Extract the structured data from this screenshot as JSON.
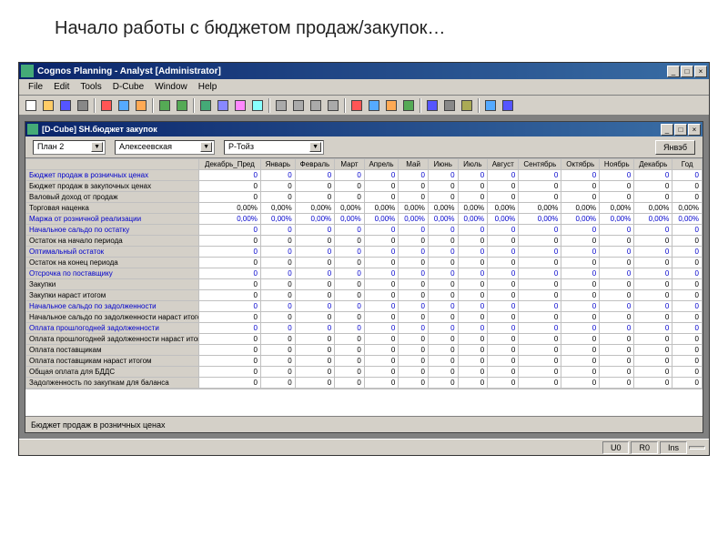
{
  "slide_title": "Начало работы с бюджетом продаж/закупок…",
  "app": {
    "title": "Cognos Planning - Analyst [Administrator]",
    "menu": [
      "File",
      "Edit",
      "Tools",
      "D-Cube",
      "Window",
      "Help"
    ],
    "inner_title": "[D-Cube] SH.бюджет закупок",
    "filters": {
      "f1": "План 2",
      "f2": "Алексеевская",
      "f3": "Р-Тойз"
    },
    "refresh": "Янвэб",
    "formula": "Бюджет продаж в розничных ценах",
    "status": {
      "u0": "U0",
      "r0": "R0",
      "ins": "Ins"
    }
  },
  "columns": [
    "Декабрь_Пред",
    "Январь",
    "Февраль",
    "Март",
    "Апрель",
    "Май",
    "Июнь",
    "Июль",
    "Август",
    "Сентябрь",
    "Октябрь",
    "Ноябрь",
    "Декабрь",
    "Год"
  ],
  "rows": [
    {
      "label": "Бюджет продаж в розничных ценах",
      "link": true,
      "vals": [
        "0",
        "0",
        "0",
        "0",
        "0",
        "0",
        "0",
        "0",
        "0",
        "0",
        "0",
        "0",
        "0",
        "0"
      ]
    },
    {
      "label": "Бюджет продаж в закупочных ценах",
      "link": false,
      "vals": [
        "0",
        "0",
        "0",
        "0",
        "0",
        "0",
        "0",
        "0",
        "0",
        "0",
        "0",
        "0",
        "0",
        "0"
      ]
    },
    {
      "label": "Валовый доход от продаж",
      "link": false,
      "vals": [
        "0",
        "0",
        "0",
        "0",
        "0",
        "0",
        "0",
        "0",
        "0",
        "0",
        "0",
        "0",
        "0",
        "0"
      ]
    },
    {
      "label": "Торговая наценка",
      "link": false,
      "vals": [
        "0,00%",
        "0,00%",
        "0,00%",
        "0,00%",
        "0,00%",
        "0,00%",
        "0,00%",
        "0,00%",
        "0,00%",
        "0,00%",
        "0,00%",
        "0,00%",
        "0,00%",
        "0,00%"
      ]
    },
    {
      "label": "Маржа от розничной реализации",
      "link": true,
      "vals": [
        "0,00%",
        "0,00%",
        "0,00%",
        "0,00%",
        "0,00%",
        "0,00%",
        "0,00%",
        "0,00%",
        "0,00%",
        "0,00%",
        "0,00%",
        "0,00%",
        "0,00%",
        "0,00%"
      ]
    },
    {
      "label": "Начальное сальдо по остатку",
      "link": true,
      "vals": [
        "0",
        "0",
        "0",
        "0",
        "0",
        "0",
        "0",
        "0",
        "0",
        "0",
        "0",
        "0",
        "0",
        "0"
      ]
    },
    {
      "label": "Остаток на начало периода",
      "link": false,
      "vals": [
        "0",
        "0",
        "0",
        "0",
        "0",
        "0",
        "0",
        "0",
        "0",
        "0",
        "0",
        "0",
        "0",
        "0"
      ]
    },
    {
      "label": "Оптимальный остаток",
      "link": true,
      "vals": [
        "0",
        "0",
        "0",
        "0",
        "0",
        "0",
        "0",
        "0",
        "0",
        "0",
        "0",
        "0",
        "0",
        "0"
      ]
    },
    {
      "label": "Остаток на конец периода",
      "link": false,
      "vals": [
        "0",
        "0",
        "0",
        "0",
        "0",
        "0",
        "0",
        "0",
        "0",
        "0",
        "0",
        "0",
        "0",
        "0"
      ]
    },
    {
      "label": "Отсрочка по поставщику",
      "link": true,
      "vals": [
        "0",
        "0",
        "0",
        "0",
        "0",
        "0",
        "0",
        "0",
        "0",
        "0",
        "0",
        "0",
        "0",
        "0"
      ]
    },
    {
      "label": "Закупки",
      "link": false,
      "vals": [
        "0",
        "0",
        "0",
        "0",
        "0",
        "0",
        "0",
        "0",
        "0",
        "0",
        "0",
        "0",
        "0",
        "0"
      ]
    },
    {
      "label": "Закупки нараст итогом",
      "link": false,
      "vals": [
        "0",
        "0",
        "0",
        "0",
        "0",
        "0",
        "0",
        "0",
        "0",
        "0",
        "0",
        "0",
        "0",
        "0"
      ]
    },
    {
      "label": "Начальное сальдо по задолженности",
      "link": true,
      "vals": [
        "0",
        "0",
        "0",
        "0",
        "0",
        "0",
        "0",
        "0",
        "0",
        "0",
        "0",
        "0",
        "0",
        "0"
      ]
    },
    {
      "label": "Начальное сальдо по задолженности нараст итогом",
      "link": false,
      "vals": [
        "0",
        "0",
        "0",
        "0",
        "0",
        "0",
        "0",
        "0",
        "0",
        "0",
        "0",
        "0",
        "0",
        "0"
      ]
    },
    {
      "label": "Оплата прошлогодней задолженности",
      "link": true,
      "vals": [
        "0",
        "0",
        "0",
        "0",
        "0",
        "0",
        "0",
        "0",
        "0",
        "0",
        "0",
        "0",
        "0",
        "0"
      ]
    },
    {
      "label": "Оплата прошлогодней задолженности нараст итогом",
      "link": false,
      "vals": [
        "0",
        "0",
        "0",
        "0",
        "0",
        "0",
        "0",
        "0",
        "0",
        "0",
        "0",
        "0",
        "0",
        "0"
      ]
    },
    {
      "label": "Оплата поставщикам",
      "link": false,
      "vals": [
        "0",
        "0",
        "0",
        "0",
        "0",
        "0",
        "0",
        "0",
        "0",
        "0",
        "0",
        "0",
        "0",
        "0"
      ]
    },
    {
      "label": "Оплата поставщикам нараст итогом",
      "link": false,
      "vals": [
        "0",
        "0",
        "0",
        "0",
        "0",
        "0",
        "0",
        "0",
        "0",
        "0",
        "0",
        "0",
        "0",
        "0"
      ]
    },
    {
      "label": "Общая оплата для БДДС",
      "link": false,
      "vals": [
        "0",
        "0",
        "0",
        "0",
        "0",
        "0",
        "0",
        "0",
        "0",
        "0",
        "0",
        "0",
        "0",
        "0"
      ]
    },
    {
      "label": "Задолженность по закупкам для баланса",
      "link": false,
      "vals": [
        "0",
        "0",
        "0",
        "0",
        "0",
        "0",
        "0",
        "0",
        "0",
        "0",
        "0",
        "0",
        "0",
        "0"
      ]
    }
  ],
  "toolbar_icons": [
    "new",
    "open",
    "save",
    "print",
    "|",
    "cut",
    "copy",
    "paste",
    "|",
    "undo",
    "redo",
    "|",
    "cube",
    "slice",
    "dimension",
    "hierarchy",
    "|",
    "filter1",
    "filter2",
    "filter3",
    "filter4",
    "|",
    "chart",
    "table",
    "pivot",
    "export",
    "|",
    "refresh",
    "calc",
    "lock",
    "|",
    "zoom",
    "help"
  ]
}
